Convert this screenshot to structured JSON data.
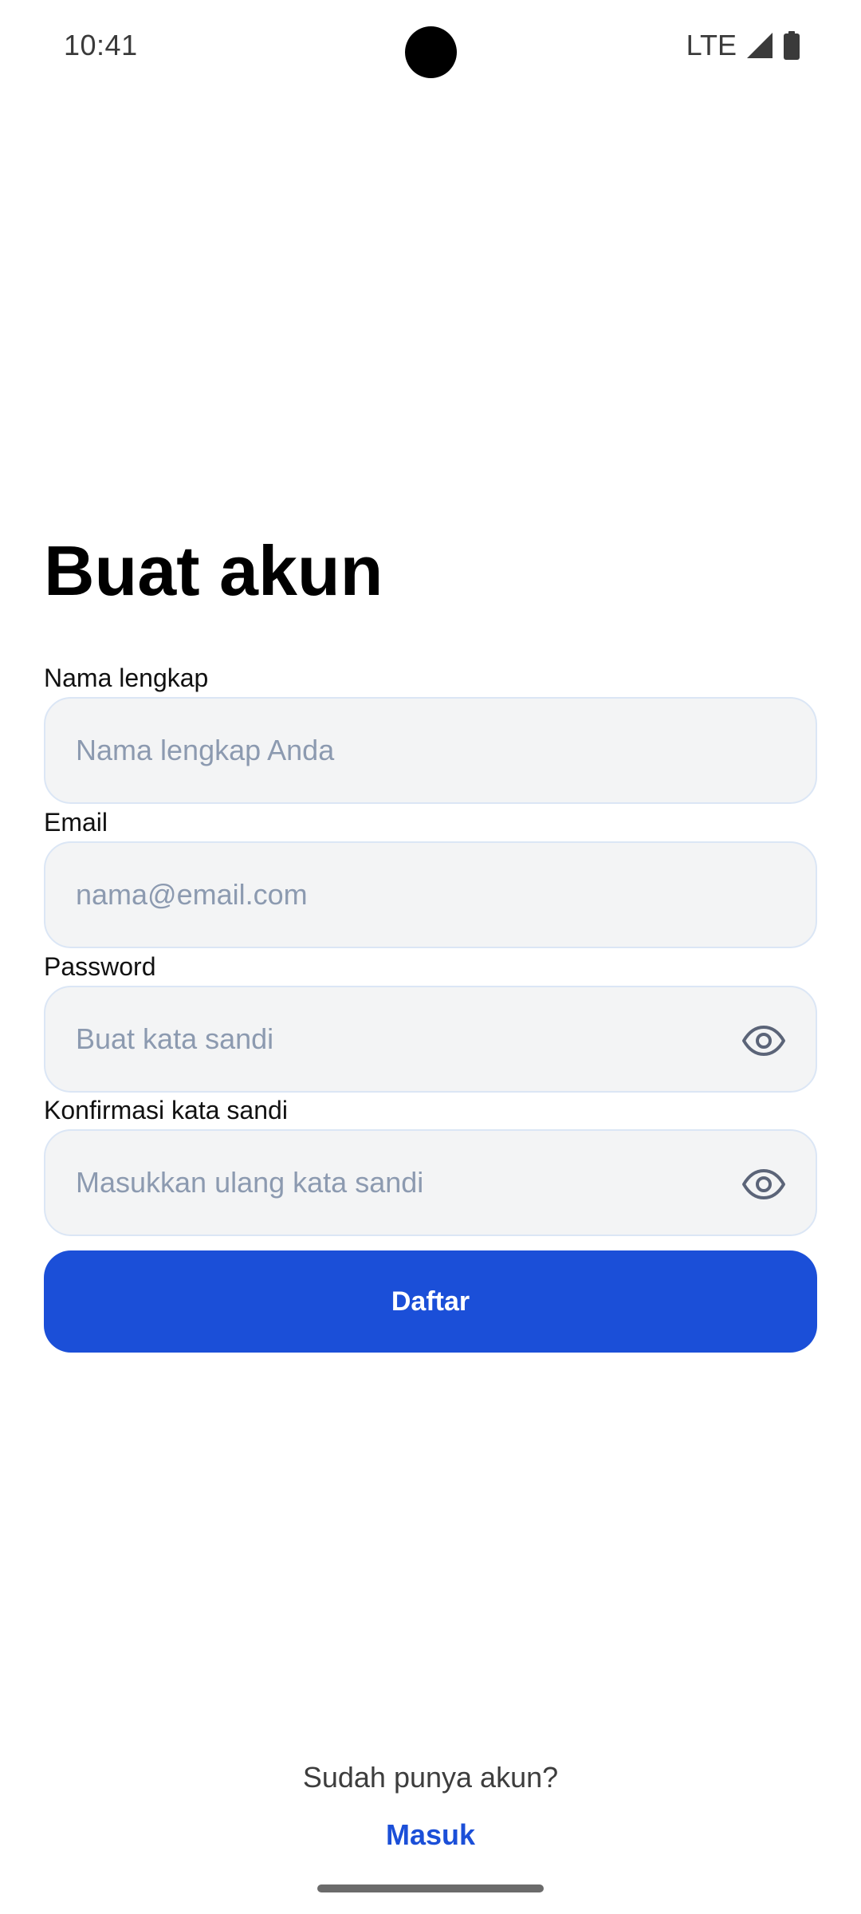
{
  "status_bar": {
    "time": "10:41",
    "network": "LTE",
    "icons": [
      "signal-icon",
      "battery-icon"
    ]
  },
  "page": {
    "title": "Buat akun"
  },
  "form": {
    "fields": [
      {
        "label": "Nama lengkap",
        "placeholder": "Nama lengkap Anda",
        "value": ""
      },
      {
        "label": "Email",
        "placeholder": "nama@email.com",
        "value": ""
      },
      {
        "label": "Password",
        "placeholder": "Buat kata sandi",
        "value": "",
        "toggle_icon": "eye-icon"
      },
      {
        "label": "Konfirmasi kata sandi",
        "placeholder": "Masukkan ulang kata sandi",
        "value": "",
        "toggle_icon": "eye-icon"
      }
    ],
    "submit_label": "Daftar"
  },
  "footer": {
    "prompt": "Sudah punya akun?",
    "link_label": "Masuk"
  },
  "colors": {
    "primary": "#1b4fd8",
    "input_bg": "#f3f4f5",
    "input_border": "#dbe6f5",
    "placeholder": "#8c9ab0"
  }
}
